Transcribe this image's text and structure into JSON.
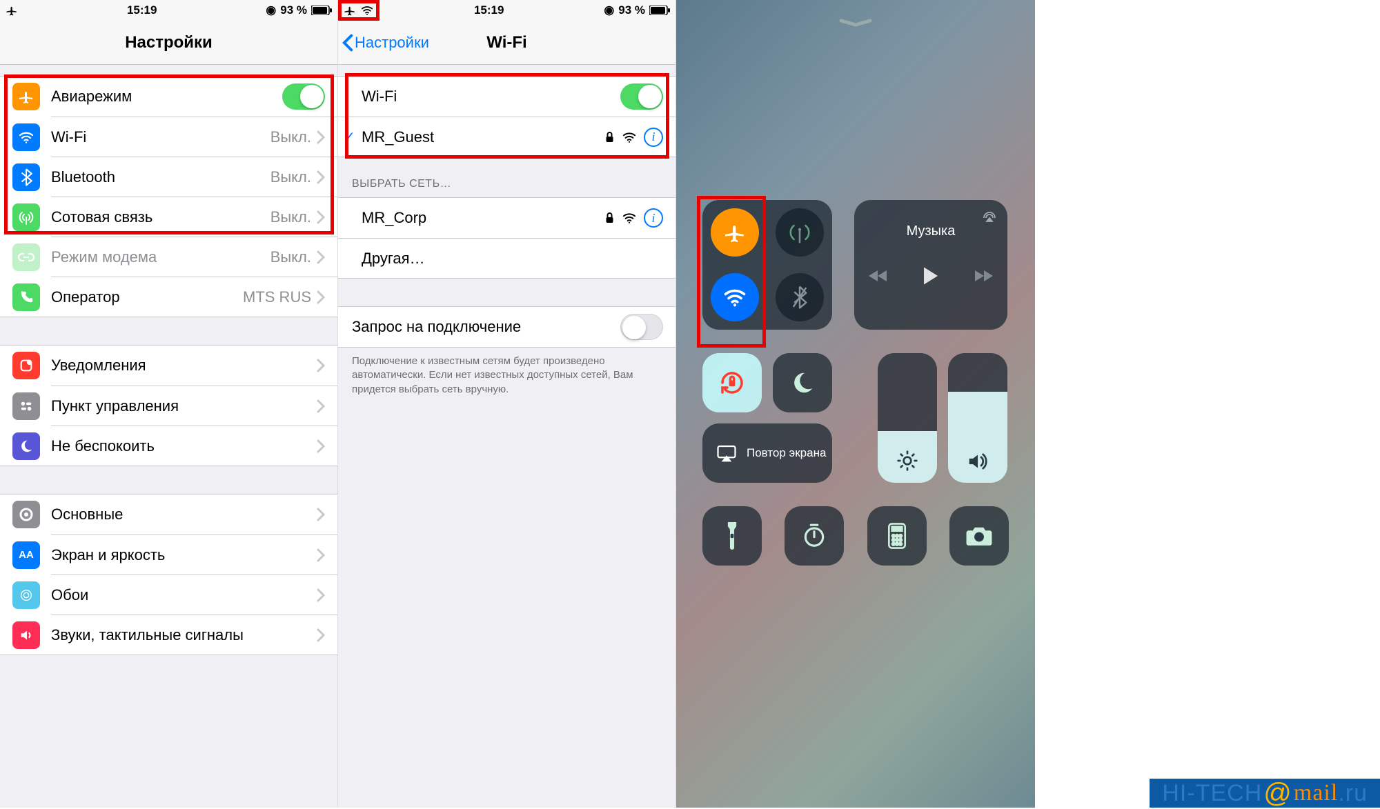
{
  "status": {
    "time": "15:19",
    "battery_pct": "93 %"
  },
  "settings": {
    "title": "Настройки",
    "rows": {
      "airplane": {
        "label": "Авиарежим"
      },
      "wifi": {
        "label": "Wi-Fi",
        "detail": "Выкл."
      },
      "bluetooth": {
        "label": "Bluetooth",
        "detail": "Выкл."
      },
      "cellular": {
        "label": "Сотовая связь",
        "detail": "Выкл."
      },
      "hotspot": {
        "label": "Режим модема",
        "detail": "Выкл."
      },
      "carrier": {
        "label": "Оператор",
        "detail": "MTS RUS"
      },
      "notifications": {
        "label": "Уведомления"
      },
      "control": {
        "label": "Пункт управления"
      },
      "dnd": {
        "label": "Не беспокоить"
      },
      "general": {
        "label": "Основные"
      },
      "display": {
        "label": "Экран и яркость"
      },
      "wallpaper": {
        "label": "Обои"
      },
      "sounds": {
        "label": "Звуки, тактильные сигналы"
      }
    }
  },
  "wifi": {
    "back": "Настройки",
    "title": "Wi-Fi",
    "toggle_label": "Wi-Fi",
    "connected": "MR_Guest",
    "choose_header": "ВЫБРАТЬ СЕТЬ…",
    "networks": {
      "0": "MR_Corp",
      "other": "Другая…"
    },
    "ask_label": "Запрос на подключение",
    "ask_footer": "Подключение к известным сетям будет произведено автоматически. Если нет известных доступных сетей, Вам придется выбрать сеть вручную."
  },
  "cc": {
    "music_title": "Музыка",
    "mirror": "Повтор экрана"
  },
  "watermark": {
    "a": "HI-TECH",
    "b": "@",
    "c": "mail",
    "d": ".ru"
  }
}
